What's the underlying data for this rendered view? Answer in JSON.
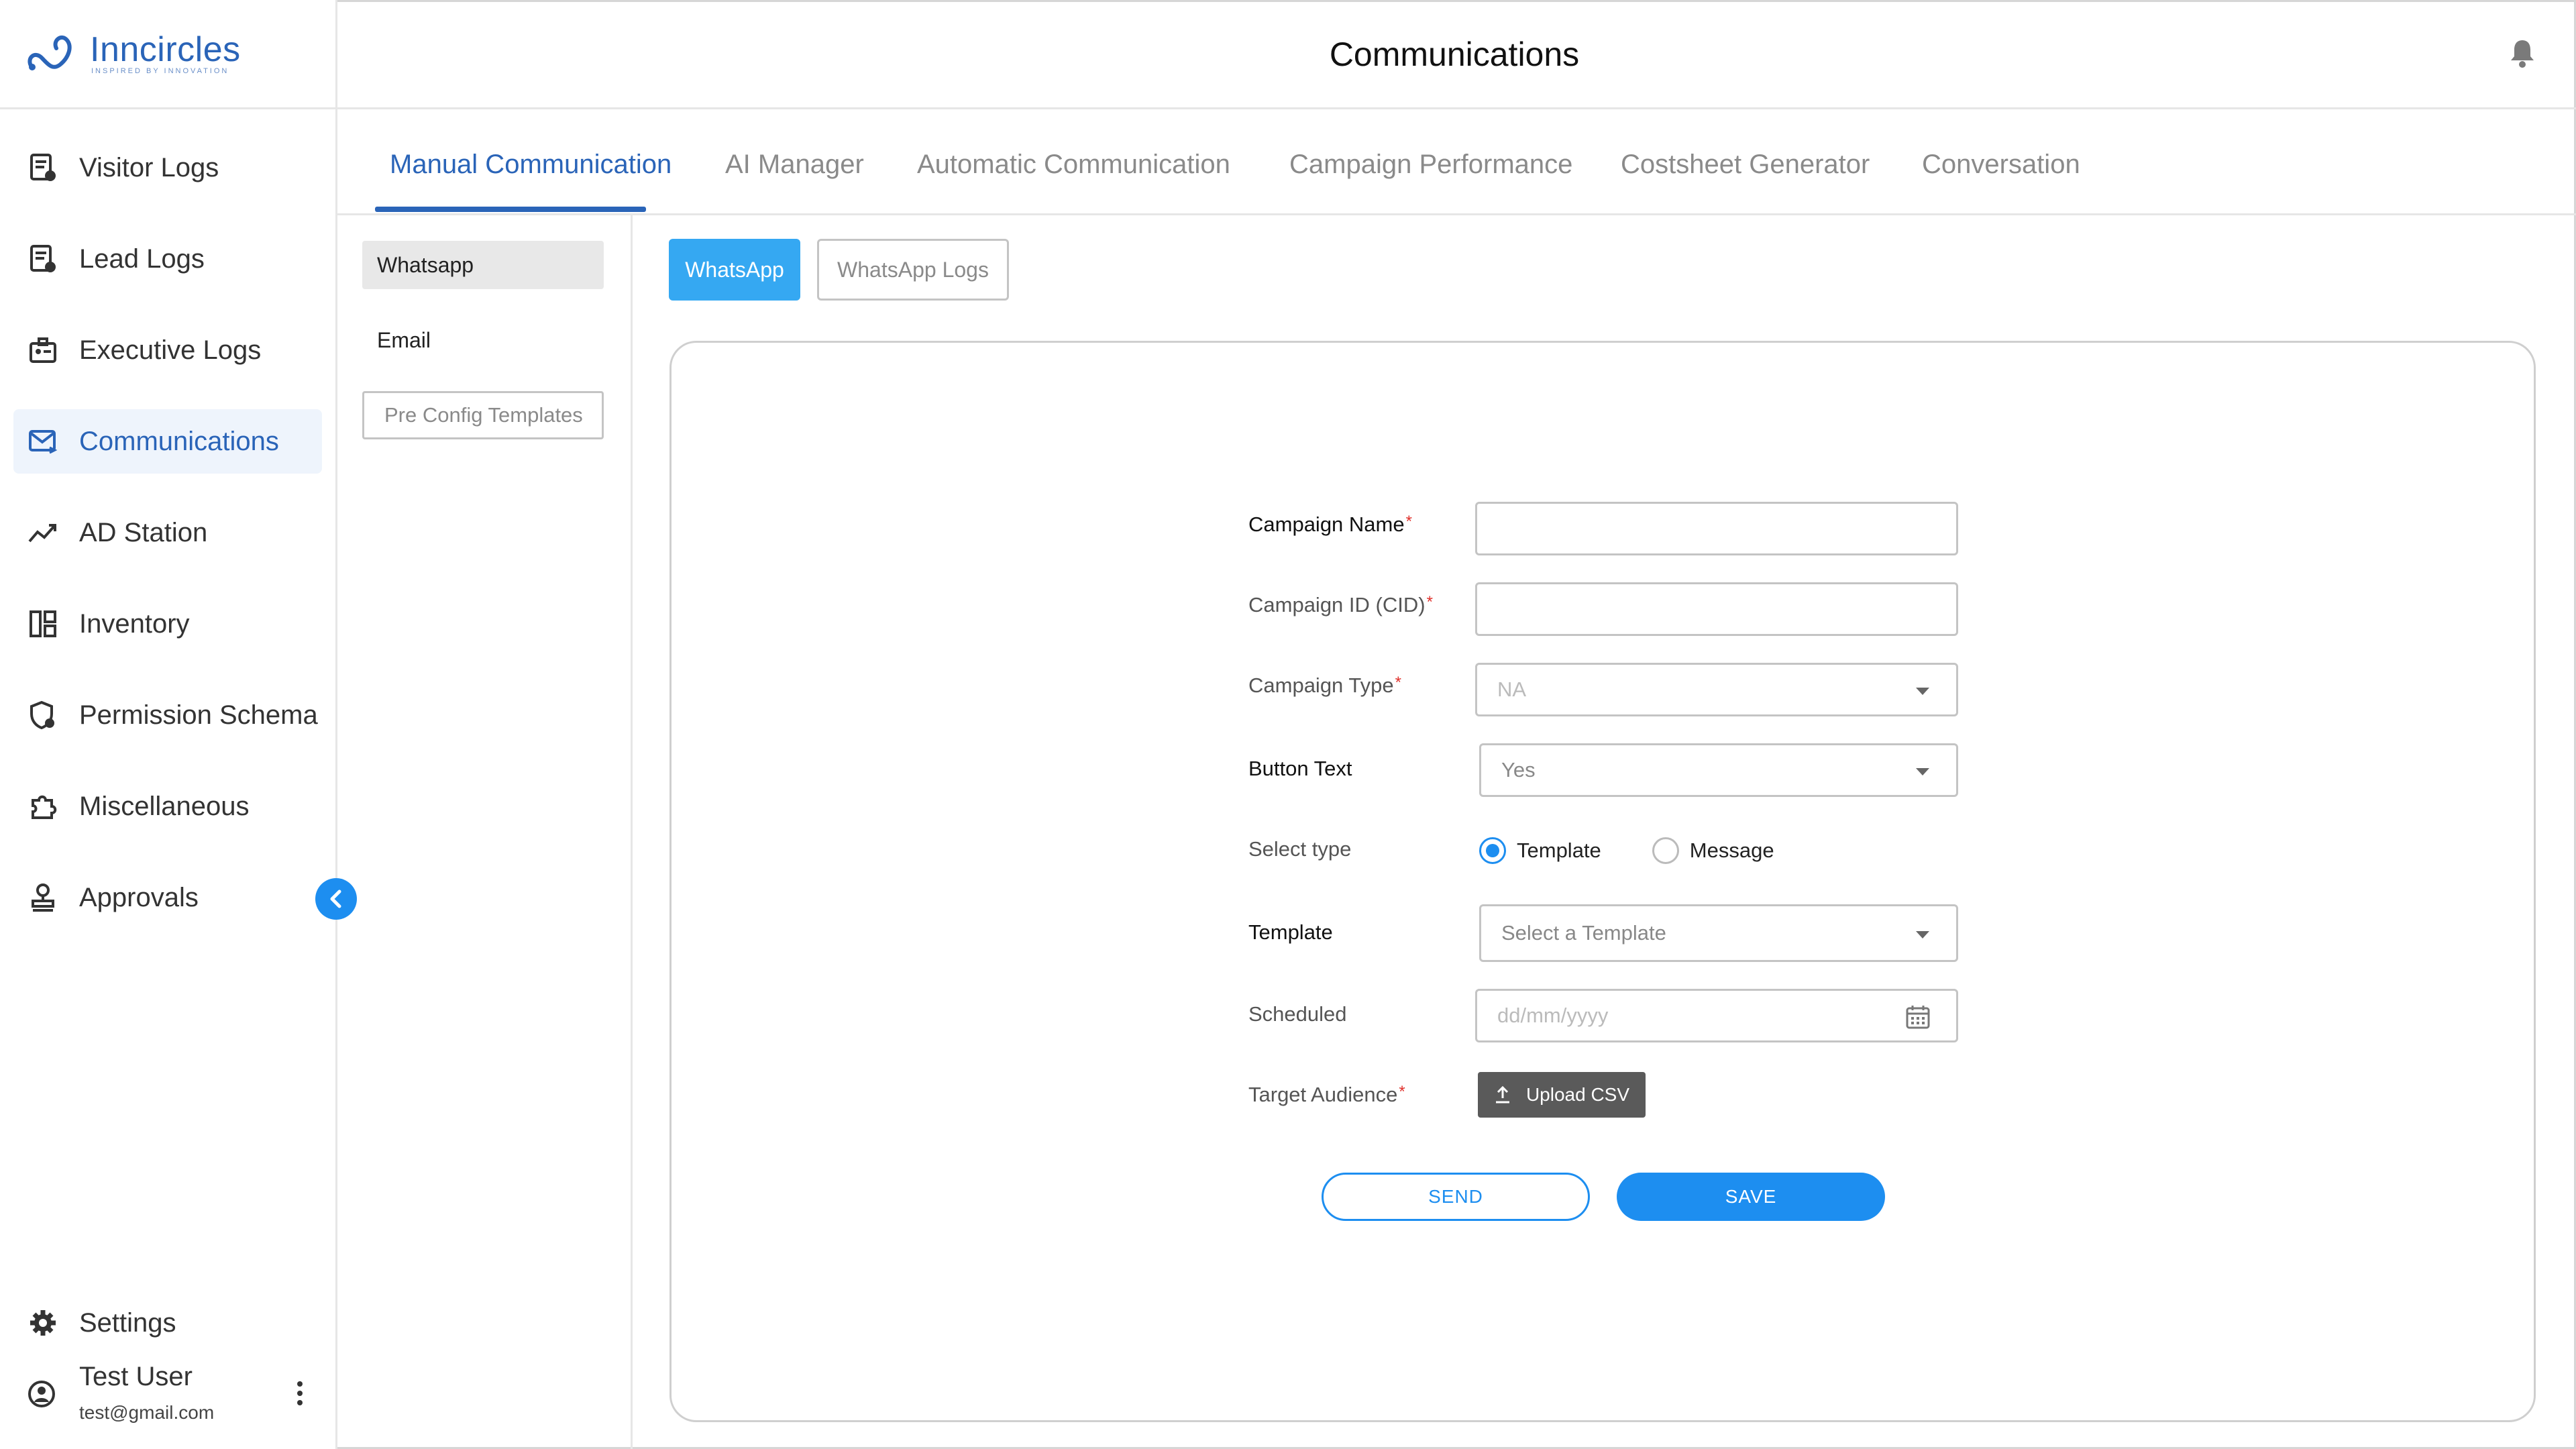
{
  "brand": {
    "name": "Inncircles",
    "tagline": "INSPIRED BY INNOVATION",
    "color": "#2a64b8"
  },
  "header": {
    "title": "Communications",
    "bell_icon": "bell-icon"
  },
  "sidebar": {
    "items": [
      {
        "label": "Visitor Logs",
        "icon": "visitor-logs-icon"
      },
      {
        "label": "Lead Logs",
        "icon": "lead-logs-icon"
      },
      {
        "label": "Executive Logs",
        "icon": "executive-logs-icon"
      },
      {
        "label": "Communications",
        "icon": "mail-icon",
        "active": true
      },
      {
        "label": "AD Station",
        "icon": "trend-icon"
      },
      {
        "label": "Inventory",
        "icon": "inventory-icon"
      },
      {
        "label": "Permission Schema",
        "icon": "shield-icon"
      },
      {
        "label": "Miscellaneous",
        "icon": "puzzle-icon"
      },
      {
        "label": "Approvals",
        "icon": "stamp-icon"
      }
    ],
    "settings_label": "Settings",
    "user": {
      "name": "Test User",
      "email": "test@gmail.com"
    }
  },
  "tabs": [
    {
      "label": "Manual Communication",
      "active": true
    },
    {
      "label": "AI Manager"
    },
    {
      "label": "Automatic Communication"
    },
    {
      "label": "Campaign Performance"
    },
    {
      "label": "Costsheet Generator"
    },
    {
      "label": "Conversation"
    }
  ],
  "subnav": {
    "whatsapp": "Whatsapp",
    "email": "Email",
    "preconfig": "Pre Config Templates"
  },
  "channel_buttons": {
    "whatsapp": "WhatsApp",
    "whatsapp_logs": "WhatsApp Logs"
  },
  "form": {
    "campaign_name": {
      "label": "Campaign Name",
      "value": ""
    },
    "campaign_id": {
      "label": "Campaign ID (CID)",
      "value": ""
    },
    "campaign_type": {
      "label": "Campaign Type",
      "value": "NA"
    },
    "button_text": {
      "label": "Button Text",
      "value": "Yes"
    },
    "select_type": {
      "label": "Select type",
      "options": [
        "Template",
        "Message"
      ],
      "selected": "Template"
    },
    "template": {
      "label": "Template",
      "placeholder": "Select a Template"
    },
    "scheduled": {
      "label": "Scheduled",
      "placeholder": "dd/mm/yyyy"
    },
    "target_audience": {
      "label": "Target Audience",
      "upload_label": "Upload CSV"
    },
    "required_mark": "*",
    "send_label": "SEND",
    "save_label": "SAVE"
  },
  "colors": {
    "accent": "#1d8ef0",
    "active_tab": "#2a64b8",
    "required": "#e0302b"
  }
}
